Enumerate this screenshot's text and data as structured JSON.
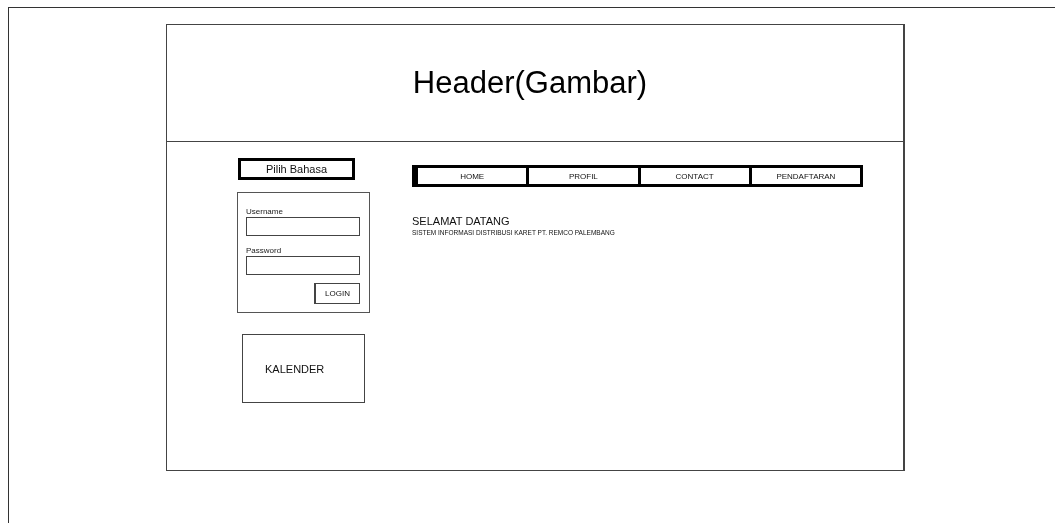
{
  "header": {
    "title": "Header(Gambar)"
  },
  "language_button": "Pilih Bahasa",
  "login": {
    "username_label": "Username",
    "password_label": "Password",
    "button": "LOGIN"
  },
  "calendar": {
    "label": "KALENDER"
  },
  "nav": [
    "HOME",
    "PROFIL",
    "CONTACT",
    "PENDAFTARAN"
  ],
  "welcome": {
    "title": "SELAMAT DATANG",
    "subtitle": "SISTEM INFORMASI DISTRIBUSI KARET PT. REMCO PALEMBANG"
  }
}
